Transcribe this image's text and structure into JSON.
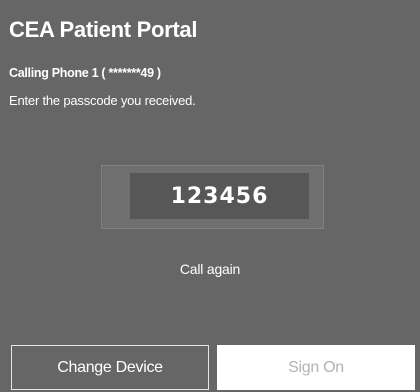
{
  "header": {
    "title": "CEA Patient Portal"
  },
  "message": {
    "calling": "Calling Phone 1 ( *******49 )",
    "instructions": "Enter the passcode you received."
  },
  "passcode": {
    "value": "123456"
  },
  "links": {
    "call_again": "Call again"
  },
  "actions": {
    "change_device": "Change Device",
    "sign_on": "Sign On"
  },
  "colors": {
    "background": "#666666",
    "input_background": "#575757",
    "primary_button": "#ffffff",
    "primary_button_text_disabled": "#b3b3b3"
  }
}
